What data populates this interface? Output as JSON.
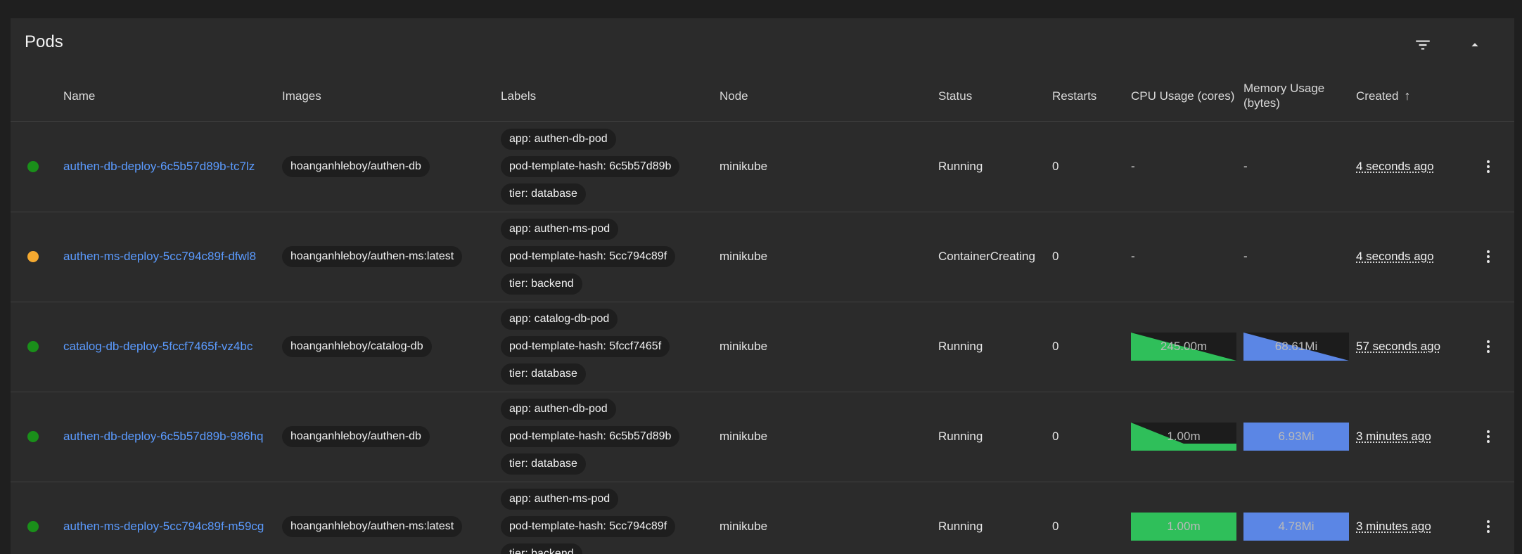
{
  "card": {
    "title": "Pods",
    "filter_icon": "filter-list-icon",
    "collapse_icon": "arrow-up-collapse-icon"
  },
  "columns": {
    "name": "Name",
    "images": "Images",
    "labels": "Labels",
    "node": "Node",
    "status": "Status",
    "restarts": "Restarts",
    "cpu": "CPU Usage (cores)",
    "memory_line1": "Memory Usage",
    "memory_line2": "(bytes)",
    "created": "Created",
    "sort_icon": "arrow-up-sort-icon"
  },
  "colors": {
    "running": "#1a8f1a",
    "pending": "#f4a930",
    "link": "#5b9bff",
    "cpu_fill": "#2fbf5a",
    "memory_fill": "#5b86e5"
  },
  "rows": [
    {
      "state": "running",
      "name": "authen-db-deploy-6c5b57d89b-tc7lz",
      "image": "hoanganhleboy/authen-db",
      "labels": [
        "app: authen-db-pod",
        "pod-template-hash: 6c5b57d89b",
        "tier: database"
      ],
      "node": "minikube",
      "status": "Running",
      "restarts": "0",
      "cpu": "-",
      "memory": "-",
      "created": "4 seconds ago"
    },
    {
      "state": "pending",
      "name": "authen-ms-deploy-5cc794c89f-dfwl8",
      "image": "hoanganhleboy/authen-ms:latest",
      "labels": [
        "app: authen-ms-pod",
        "pod-template-hash: 5cc794c89f",
        "tier: backend"
      ],
      "node": "minikube",
      "status": "ContainerCreating",
      "restarts": "0",
      "cpu": "-",
      "memory": "-",
      "created": "4 seconds ago"
    },
    {
      "state": "running",
      "name": "catalog-db-deploy-5fccf7465f-vz4bc",
      "image": "hoanganhleboy/catalog-db",
      "labels": [
        "app: catalog-db-pod",
        "pod-template-hash: 5fccf7465f",
        "tier: database"
      ],
      "node": "minikube",
      "status": "Running",
      "restarts": "0",
      "cpu": "245.00m",
      "memory": "68.61Mi",
      "created": "57 seconds ago"
    },
    {
      "state": "running",
      "name": "authen-db-deploy-6c5b57d89b-986hq",
      "image": "hoanganhleboy/authen-db",
      "labels": [
        "app: authen-db-pod",
        "pod-template-hash: 6c5b57d89b",
        "tier: database"
      ],
      "node": "minikube",
      "status": "Running",
      "restarts": "0",
      "cpu": "1.00m",
      "memory": "6.93Mi",
      "created": "3 minutes ago"
    },
    {
      "state": "running",
      "name": "authen-ms-deploy-5cc794c89f-m59cg",
      "image": "hoanganhleboy/authen-ms:latest",
      "labels": [
        "app: authen-ms-pod",
        "pod-template-hash: 5cc794c89f",
        "tier: backend"
      ],
      "node": "minikube",
      "status": "Running",
      "restarts": "0",
      "cpu": "1.00m",
      "memory": "4.78Mi",
      "created": "3 minutes ago"
    }
  ]
}
